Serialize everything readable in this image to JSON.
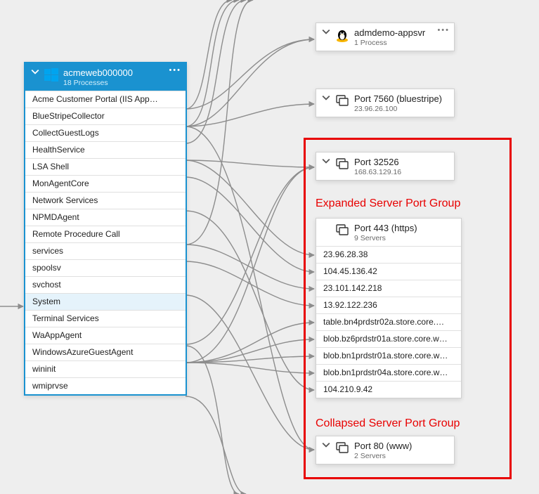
{
  "source_node": {
    "title": "acmeweb000000",
    "subtitle": "18 Processes",
    "os": "windows",
    "processes": [
      "Acme Customer Portal (IIS App…",
      "BlueStripeCollector",
      "CollectGuestLogs",
      "HealthService",
      "LSA Shell",
      "MonAgentCore",
      "Network Services",
      "NPMDAgent",
      "Remote Procedure Call",
      "services",
      "spoolsv",
      "svchost",
      "System",
      "Terminal Services",
      "WaAppAgent",
      "WindowsAzureGuestAgent",
      "wininit",
      "wmiprvse"
    ],
    "selected_index": 12
  },
  "targets": {
    "appsvr": {
      "title": "admdemo-appsvr",
      "subtitle": "1 Process",
      "os": "linux"
    },
    "port7560": {
      "title": "Port 7560 (bluestripe)",
      "subtitle": "23.96.26.100"
    },
    "port32526": {
      "title": "Port 32526",
      "subtitle": "168.63.129.16"
    },
    "port443": {
      "title": "Port 443 (https)",
      "subtitle": "9 Servers",
      "servers": [
        "23.96.28.38",
        "104.45.136.42",
        "23.101.142.218",
        "13.92.122.236",
        "table.bn4prdstr02a.store.core.…",
        "blob.bz6prdstr01a.store.core.w…",
        "blob.bn1prdstr01a.store.core.w…",
        "blob.bn1prdstr04a.store.core.w…",
        "104.210.9.42"
      ]
    },
    "port80": {
      "title": "Port 80 (www)",
      "subtitle": "2 Servers"
    }
  },
  "annotations": {
    "expanded": "Expanded Server Port Group",
    "collapsed": "Collapsed Server Port Group"
  }
}
